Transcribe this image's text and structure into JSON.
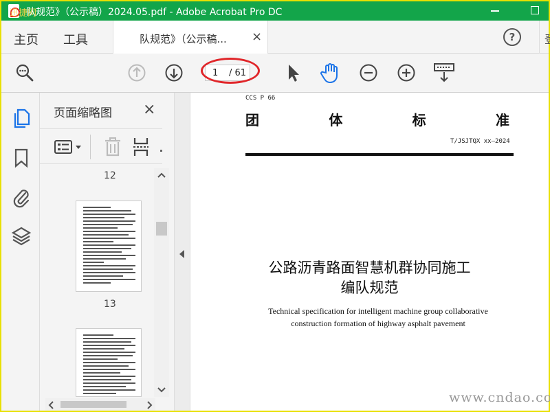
{
  "window": {
    "title": "队规范》（公示稿）2024.05.pdf - Adobe Acrobat Pro DC",
    "watermark_left": "迅捷网"
  },
  "menubar": {
    "home": "主页",
    "tools": "工具",
    "tab_label": "队规范》（公示稿...",
    "tab_close": "×",
    "help": "?",
    "user_partial": "登"
  },
  "toolbar": {
    "current_page": "1",
    "total_pages": "/ 61",
    "icons": [
      "zoom-search-icon",
      "prev-page-icon",
      "next-page-icon",
      "select-arrow-icon",
      "hand-tool-icon",
      "zoom-out-icon",
      "zoom-in-icon",
      "keyboard-scroll-icon"
    ],
    "colors": {
      "accent": "#1a73e8",
      "highlight_ellipse": "#e0262a"
    }
  },
  "rail": {
    "icons": [
      "page-thumbnails-icon",
      "bookmark-icon",
      "attachment-icon",
      "layers-icon"
    ]
  },
  "thumbnails_panel": {
    "title": "页面缩略图",
    "close": "×",
    "page_labels": [
      "12",
      "13"
    ]
  },
  "document": {
    "ccs": "CCS P 66",
    "standard_chars": [
      "团",
      "体",
      "标",
      "准"
    ],
    "code": "T/JSJTQX xx—2024",
    "title_line1": "公路沥青路面智慧机群协同施工",
    "title_line2": "编队规范",
    "english_line1": "Technical specification for intelligent machine group collaborative",
    "english_line2": "construction formation of highway asphalt pavement"
  },
  "watermark": "www.cndao.com"
}
